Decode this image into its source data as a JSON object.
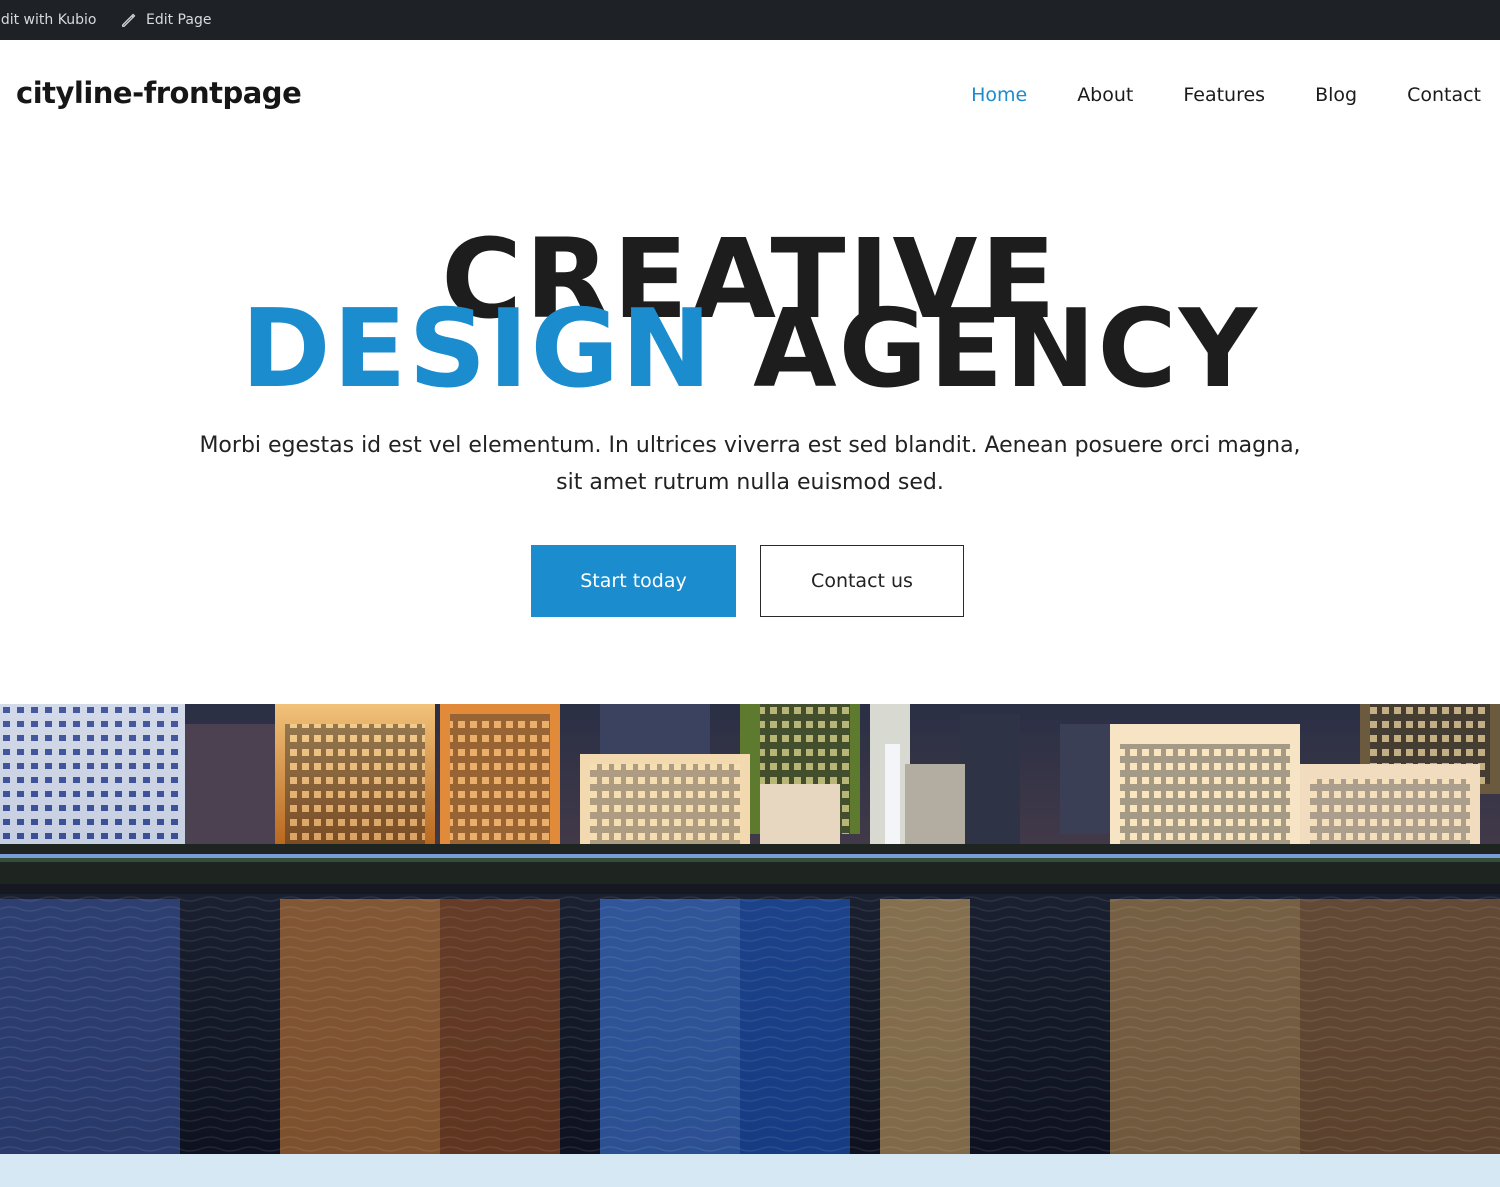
{
  "admin_bar": {
    "kubio_label": "Edit with Kubio",
    "edit_page_label": "Edit Page"
  },
  "header": {
    "site_title": "cityline-frontpage",
    "nav": [
      {
        "label": "Home",
        "active": true
      },
      {
        "label": "About"
      },
      {
        "label": "Features"
      },
      {
        "label": "Blog"
      },
      {
        "label": "Contact"
      }
    ]
  },
  "hero": {
    "line1": "CREATIVE",
    "line2_accent": "DESIGN",
    "line2_rest": "AGENCY",
    "description_line1": "Morbi egestas id est vel elementum. In ultrices viverra est sed blandit. Aenean posuere orci magna,",
    "description_line2": "sit amet rutrum nulla euismod sed.",
    "primary_button": "Start today",
    "secondary_button": "Contact us"
  },
  "colors": {
    "accent": "#1b8cce",
    "admin_bar": "#1e2126",
    "bottom_band": "#d5e8f4"
  },
  "icons": {
    "edit_page": "pencil-icon"
  }
}
